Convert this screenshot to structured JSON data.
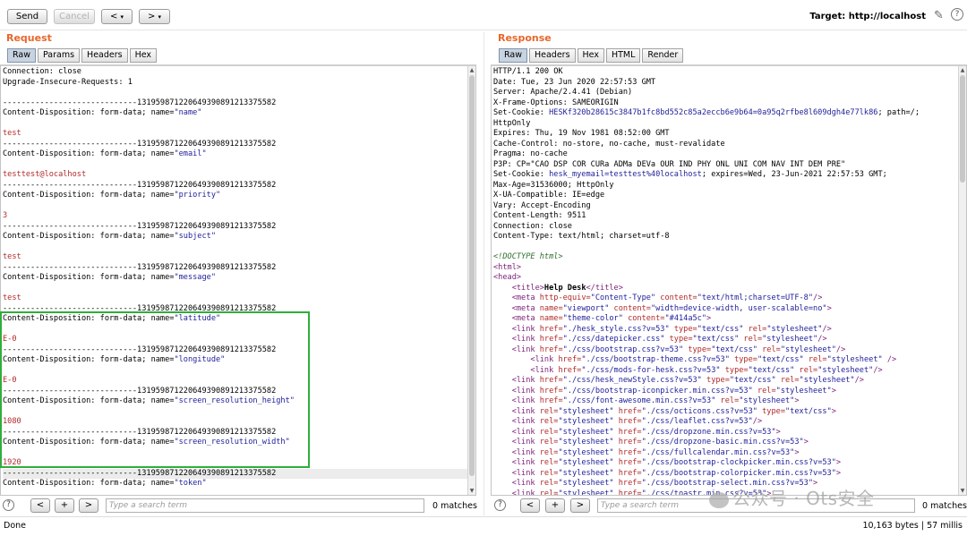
{
  "toolbar": {
    "send_label": "Send",
    "cancel_label": "Cancel",
    "back_label": "<",
    "back_dd": "▾",
    "fwd_label": ">",
    "fwd_dd": "▾",
    "target_label": "Target: http://localhost",
    "edit_icon": "pencil-icon",
    "help_icon": "?"
  },
  "request": {
    "title": "Request",
    "tabs": [
      "Raw",
      "Params",
      "Headers",
      "Hex"
    ],
    "active_tab": "Raw",
    "lines": [
      {
        "t": "Connection: close"
      },
      {
        "t": "Upgrade-Insecure-Requests: 1"
      },
      {
        "t": ""
      },
      {
        "t": "-----------------------------131959871220649390891213375582"
      },
      {
        "t": "Content-Disposition: form-data; name=",
        "q": "\"name\""
      },
      {
        "t": ""
      },
      {
        "t": "test",
        "v": true
      },
      {
        "t": "-----------------------------131959871220649390891213375582"
      },
      {
        "t": "Content-Disposition: form-data; name=",
        "q": "\"email\""
      },
      {
        "t": ""
      },
      {
        "t": "testtest@localhost",
        "v": true
      },
      {
        "t": "-----------------------------131959871220649390891213375582"
      },
      {
        "t": "Content-Disposition: form-data; name=",
        "q": "\"priority\""
      },
      {
        "t": ""
      },
      {
        "t": "3",
        "v": true
      },
      {
        "t": "-----------------------------131959871220649390891213375582"
      },
      {
        "t": "Content-Disposition: form-data; name=",
        "q": "\"subject\""
      },
      {
        "t": ""
      },
      {
        "t": "test",
        "v": true
      },
      {
        "t": "-----------------------------131959871220649390891213375582"
      },
      {
        "t": "Content-Disposition: form-data; name=",
        "q": "\"message\""
      },
      {
        "t": ""
      },
      {
        "t": "test",
        "v": true
      },
      {
        "t": "-----------------------------131959871220649390891213375582"
      },
      {
        "t": "Content-Disposition: form-data; name=",
        "q": "\"latitude\""
      },
      {
        "t": ""
      },
      {
        "t": "E-0",
        "v": true
      },
      {
        "t": "-----------------------------131959871220649390891213375582"
      },
      {
        "t": "Content-Disposition: form-data; name=",
        "q": "\"longitude\""
      },
      {
        "t": ""
      },
      {
        "t": "E-0",
        "v": true
      },
      {
        "t": "-----------------------------131959871220649390891213375582"
      },
      {
        "t": "Content-Disposition: form-data; name=",
        "q": "\"screen_resolution_height\""
      },
      {
        "t": ""
      },
      {
        "t": "1080",
        "v": true
      },
      {
        "t": "-----------------------------131959871220649390891213375582"
      },
      {
        "t": "Content-Disposition: form-data; name=",
        "q": "\"screen_resolution_width\""
      },
      {
        "t": ""
      },
      {
        "t": "1920",
        "v": true
      },
      {
        "t": "-----------------------------131959871220649390891213375582",
        "hl": true
      },
      {
        "t": "Content-Disposition: form-data; name=",
        "q": "\"token\""
      }
    ],
    "search_placeholder": "Type a search term",
    "matches": "0 matches"
  },
  "response": {
    "title": "Response",
    "tabs": [
      "Raw",
      "Headers",
      "Hex",
      "HTML",
      "Render"
    ],
    "active_tab": "Raw",
    "lines": [
      {
        "t": "HTTP/1.1 200 OK"
      },
      {
        "t": "Date: Tue, 23 Jun 2020 22:57:53 GMT"
      },
      {
        "t": "Server: Apache/2.4.41 (Debian)"
      },
      {
        "t": "X-Frame-Options: SAMEORIGIN"
      },
      {
        "t": "Set-Cookie: ",
        "c": "HESKf320b28615c3847b1fc8bd552c85a2eccb6e9b64=0a95q2rfbe8l609dgh4e77lk86",
        "r": "; path=/;"
      },
      {
        "t": "HttpOnly"
      },
      {
        "t": "Expires: Thu, 19 Nov 1981 08:52:00 GMT"
      },
      {
        "t": "Cache-Control: no-store, no-cache, must-revalidate"
      },
      {
        "t": "Pragma: no-cache"
      },
      {
        "t": "P3P: CP=\"CAO DSP COR CURa ADMa DEVa OUR IND PHY ONL UNI COM NAV INT DEM PRE\""
      },
      {
        "t": "Set-Cookie: ",
        "c": "hesk_myemail=testtest%40localhost",
        "r": "; expires=Wed, 23-Jun-2021 22:57:53 GMT;"
      },
      {
        "t": "Max-Age=31536000; HttpOnly"
      },
      {
        "t": "X-UA-Compatible: IE=edge"
      },
      {
        "t": "Vary: Accept-Encoding"
      },
      {
        "t": "Content-Length: 9511"
      },
      {
        "t": "Connection: close"
      },
      {
        "t": "Content-Type: text/html; charset=utf-8"
      },
      {
        "t": ""
      },
      {
        "dt": "<!DOCTYPE html>"
      },
      {
        "h": [
          [
            "tg",
            "<html>"
          ]
        ]
      },
      {
        "h": [
          [
            "tg",
            "<head>"
          ]
        ]
      },
      {
        "i": "    ",
        "h": [
          [
            "tg",
            "<title>"
          ],
          [
            "b",
            "Help Desk"
          ],
          [
            "tg",
            "</title>"
          ]
        ]
      },
      {
        "i": "    ",
        "h": [
          [
            "tg",
            "<meta "
          ],
          [
            "at",
            "http-equiv="
          ],
          [
            "av",
            "\"Content-Type\" "
          ],
          [
            "at",
            "content="
          ],
          [
            "av",
            "\"text/html;charset=UTF-8\""
          ],
          [
            "tg",
            "/>"
          ]
        ]
      },
      {
        "i": "    ",
        "h": [
          [
            "tg",
            "<meta "
          ],
          [
            "at",
            "name="
          ],
          [
            "av",
            "\"viewport\" "
          ],
          [
            "at",
            "content="
          ],
          [
            "av",
            "\"width=device-width, user-scalable=no\""
          ],
          [
            "tg",
            ">"
          ]
        ]
      },
      {
        "i": "    ",
        "h": [
          [
            "tg",
            "<meta "
          ],
          [
            "at",
            "name="
          ],
          [
            "av",
            "\"theme-color\" "
          ],
          [
            "at",
            "content="
          ],
          [
            "av",
            "\"#414a5c\""
          ],
          [
            "tg",
            ">"
          ]
        ]
      },
      {
        "i": "    ",
        "h": [
          [
            "tg",
            "<link "
          ],
          [
            "at",
            "href="
          ],
          [
            "av",
            "\"./hesk_style.css?v=53\" "
          ],
          [
            "at",
            "type="
          ],
          [
            "av",
            "\"text/css\" "
          ],
          [
            "at",
            "rel="
          ],
          [
            "av",
            "\"stylesheet\""
          ],
          [
            "tg",
            "/>"
          ]
        ]
      },
      {
        "i": "    ",
        "h": [
          [
            "tg",
            "<link "
          ],
          [
            "at",
            "href="
          ],
          [
            "av",
            "\"./css/datepicker.css\" "
          ],
          [
            "at",
            "type="
          ],
          [
            "av",
            "\"text/css\" "
          ],
          [
            "at",
            "rel="
          ],
          [
            "av",
            "\"stylesheet\""
          ],
          [
            "tg",
            "/>"
          ]
        ]
      },
      {
        "i": "    ",
        "h": [
          [
            "tg",
            "<link "
          ],
          [
            "at",
            "href="
          ],
          [
            "av",
            "\"./css/bootstrap.css?v=53\" "
          ],
          [
            "at",
            "type="
          ],
          [
            "av",
            "\"text/css\" "
          ],
          [
            "at",
            "rel="
          ],
          [
            "av",
            "\"stylesheet\""
          ],
          [
            "tg",
            "/>"
          ]
        ]
      },
      {
        "i": "        ",
        "h": [
          [
            "tg",
            "<link "
          ],
          [
            "at",
            "href="
          ],
          [
            "av",
            "\"./css/bootstrap-theme.css?v=53\" "
          ],
          [
            "at",
            "type="
          ],
          [
            "av",
            "\"text/css\" "
          ],
          [
            "at",
            "rel="
          ],
          [
            "av",
            "\"stylesheet\" "
          ],
          [
            "tg",
            "/>"
          ]
        ]
      },
      {
        "i": "        ",
        "h": [
          [
            "tg",
            "<link "
          ],
          [
            "at",
            "href="
          ],
          [
            "av",
            "\"./css/mods-for-hesk.css?v=53\" "
          ],
          [
            "at",
            "type="
          ],
          [
            "av",
            "\"text/css\" "
          ],
          [
            "at",
            "rel="
          ],
          [
            "av",
            "\"stylesheet\""
          ],
          [
            "tg",
            "/>"
          ]
        ]
      },
      {
        "i": "    ",
        "h": [
          [
            "tg",
            "<link "
          ],
          [
            "at",
            "href="
          ],
          [
            "av",
            "\"./css/hesk_newStyle.css?v=53\" "
          ],
          [
            "at",
            "type="
          ],
          [
            "av",
            "\"text/css\" "
          ],
          [
            "at",
            "rel="
          ],
          [
            "av",
            "\"stylesheet\""
          ],
          [
            "tg",
            "/>"
          ]
        ]
      },
      {
        "i": "    ",
        "h": [
          [
            "tg",
            "<link "
          ],
          [
            "at",
            "href="
          ],
          [
            "av",
            "\"./css/bootstrap-iconpicker.min.css?v=53\" "
          ],
          [
            "at",
            "rel="
          ],
          [
            "av",
            "\"stylesheet\""
          ],
          [
            "tg",
            ">"
          ]
        ]
      },
      {
        "i": "    ",
        "h": [
          [
            "tg",
            "<link "
          ],
          [
            "at",
            "href="
          ],
          [
            "av",
            "\"./css/font-awesome.min.css?v=53\" "
          ],
          [
            "at",
            "rel="
          ],
          [
            "av",
            "\"stylesheet\""
          ],
          [
            "tg",
            ">"
          ]
        ]
      },
      {
        "i": "    ",
        "h": [
          [
            "tg",
            "<link "
          ],
          [
            "at",
            "rel="
          ],
          [
            "av",
            "\"stylesheet\" "
          ],
          [
            "at",
            "href="
          ],
          [
            "av",
            "\"./css/octicons.css?v=53\" "
          ],
          [
            "at",
            "type="
          ],
          [
            "av",
            "\"text/css\""
          ],
          [
            "tg",
            ">"
          ]
        ]
      },
      {
        "i": "    ",
        "h": [
          [
            "tg",
            "<link "
          ],
          [
            "at",
            "rel="
          ],
          [
            "av",
            "\"stylesheet\" "
          ],
          [
            "at",
            "href="
          ],
          [
            "av",
            "\"./css/leaflet.css?v=53\""
          ],
          [
            "tg",
            "/>"
          ]
        ]
      },
      {
        "i": "    ",
        "h": [
          [
            "tg",
            "<link "
          ],
          [
            "at",
            "rel="
          ],
          [
            "av",
            "\"stylesheet\" "
          ],
          [
            "at",
            "href="
          ],
          [
            "av",
            "\"./css/dropzone.min.css?v=53\""
          ],
          [
            "tg",
            ">"
          ]
        ]
      },
      {
        "i": "    ",
        "h": [
          [
            "tg",
            "<link "
          ],
          [
            "at",
            "rel="
          ],
          [
            "av",
            "\"stylesheet\" "
          ],
          [
            "at",
            "href="
          ],
          [
            "av",
            "\"./css/dropzone-basic.min.css?v=53\""
          ],
          [
            "tg",
            ">"
          ]
        ]
      },
      {
        "i": "    ",
        "h": [
          [
            "tg",
            "<link "
          ],
          [
            "at",
            "rel="
          ],
          [
            "av",
            "\"stylesheet\" "
          ],
          [
            "at",
            "href="
          ],
          [
            "av",
            "\"./css/fullcalendar.min.css?v=53\""
          ],
          [
            "tg",
            ">"
          ]
        ]
      },
      {
        "i": "    ",
        "h": [
          [
            "tg",
            "<link "
          ],
          [
            "at",
            "rel="
          ],
          [
            "av",
            "\"stylesheet\" "
          ],
          [
            "at",
            "href="
          ],
          [
            "av",
            "\"./css/bootstrap-clockpicker.min.css?v=53\""
          ],
          [
            "tg",
            ">"
          ]
        ]
      },
      {
        "i": "    ",
        "h": [
          [
            "tg",
            "<link "
          ],
          [
            "at",
            "rel="
          ],
          [
            "av",
            "\"stylesheet\" "
          ],
          [
            "at",
            "href="
          ],
          [
            "av",
            "\"./css/bootstrap-colorpicker.min.css?v=53\""
          ],
          [
            "tg",
            ">"
          ]
        ]
      },
      {
        "i": "    ",
        "h": [
          [
            "tg",
            "<link "
          ],
          [
            "at",
            "rel="
          ],
          [
            "av",
            "\"stylesheet\" "
          ],
          [
            "at",
            "href="
          ],
          [
            "av",
            "\"./css/bootstrap-select.min.css?v=53\""
          ],
          [
            "tg",
            ">"
          ]
        ]
      },
      {
        "i": "    ",
        "h": [
          [
            "tg",
            "<link "
          ],
          [
            "at",
            "rel="
          ],
          [
            "av",
            "\"stylesheet\" "
          ],
          [
            "at",
            "href="
          ],
          [
            "av",
            "\"./css/toastr.min.css?v=53\""
          ],
          [
            "tg",
            ">"
          ]
        ]
      }
    ],
    "search_placeholder": "Type a search term",
    "matches": "0 matches"
  },
  "status": {
    "left": "Done",
    "right": "10,163 bytes | 57 millis"
  },
  "watermark": "公众号 · Ots安全",
  "colors": {
    "accent": "#e8672b",
    "highlight_box": "#2fae3a"
  }
}
